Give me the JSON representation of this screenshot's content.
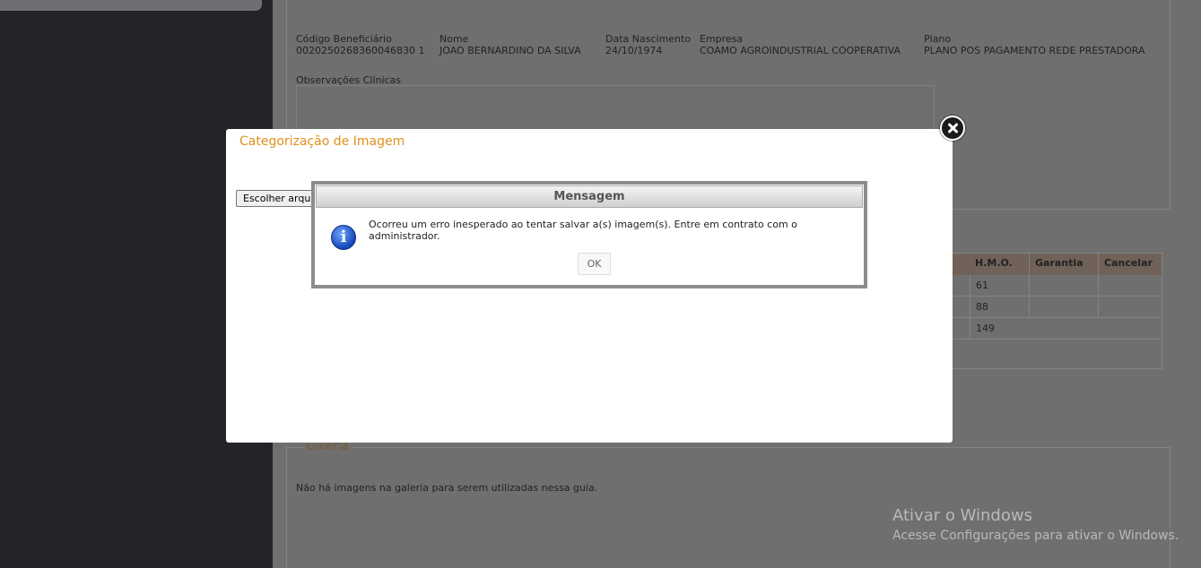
{
  "beneficiary": {
    "code_label": "Código Beneficiário",
    "code_value": "0020250268360046830 1",
    "name_label": "Nome",
    "name_value": "JOAO BERNARDINO DA SILVA",
    "birth_label": "Data Nascimento",
    "birth_value": "24/10/1974",
    "company_label": "Empresa",
    "company_value": "COAMO AGROINDUSTRIAL COOPERATIVA",
    "plan_label": "Plano",
    "plan_value": "PLANO POS PAGAMENTO REDE PRESTADORA"
  },
  "observations_label": "Observações Clínicas",
  "procedures_table": {
    "headers": [
      "H.M.O.",
      "Garantia",
      "Cancelar"
    ],
    "rows": [
      [
        "61"
      ],
      [
        "88"
      ],
      [
        "149"
      ]
    ]
  },
  "gallery": {
    "title": "Galeria",
    "empty_text": "Não há imagens na galeria para serem utilizadas nessa guia."
  },
  "modal": {
    "title": "Categorização de Imagem",
    "file_button": "Escolher arquivo"
  },
  "message_dialog": {
    "title": "Mensagem",
    "text": "Ocorreu um erro inesperado ao tentar salvar a(s) imagem(s). Entre em contrato com o administrador.",
    "ok_label": "OK",
    "icon_glyph": "i"
  },
  "watermark": {
    "line1": "Ativar o Windows",
    "line2": "Acesse Configurações para ativar o Windows."
  }
}
